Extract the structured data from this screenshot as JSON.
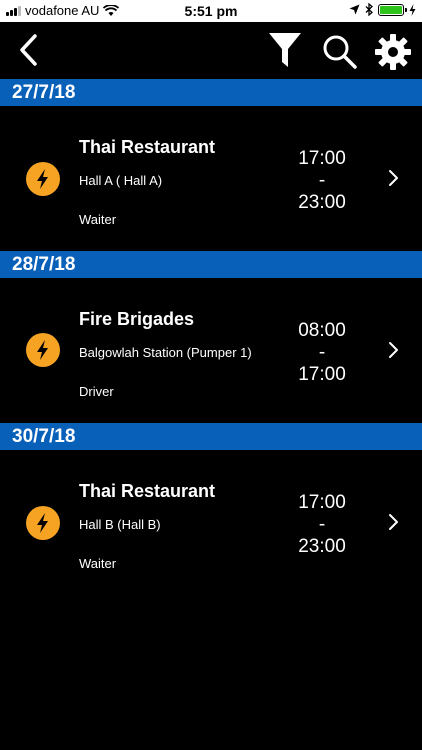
{
  "status_bar": {
    "carrier": "vodafone AU",
    "time": "5:51 pm"
  },
  "nav": {
    "icons": [
      "back-arrow",
      "filter",
      "search",
      "gear"
    ]
  },
  "sections": [
    {
      "date": "27/7/18",
      "shift": {
        "title": "Thai Restaurant",
        "location": "Hall A ( Hall A)",
        "role": "Waiter",
        "start": "17:00",
        "sep": "-",
        "end": "23:00"
      }
    },
    {
      "date": "28/7/18",
      "shift": {
        "title": "Fire Brigades",
        "location": "Balgowlah Station (Pumper 1)",
        "role": "Driver",
        "start": "08:00",
        "sep": "-",
        "end": "17:00"
      }
    },
    {
      "date": "30/7/18",
      "shift": {
        "title": "Thai Restaurant",
        "location": "Hall B (Hall B)",
        "role": "Waiter",
        "start": "17:00",
        "sep": "-",
        "end": "23:00"
      }
    }
  ],
  "colors": {
    "header_blue": "#0960b9",
    "badge_orange": "#f6a324",
    "background": "#000000"
  }
}
